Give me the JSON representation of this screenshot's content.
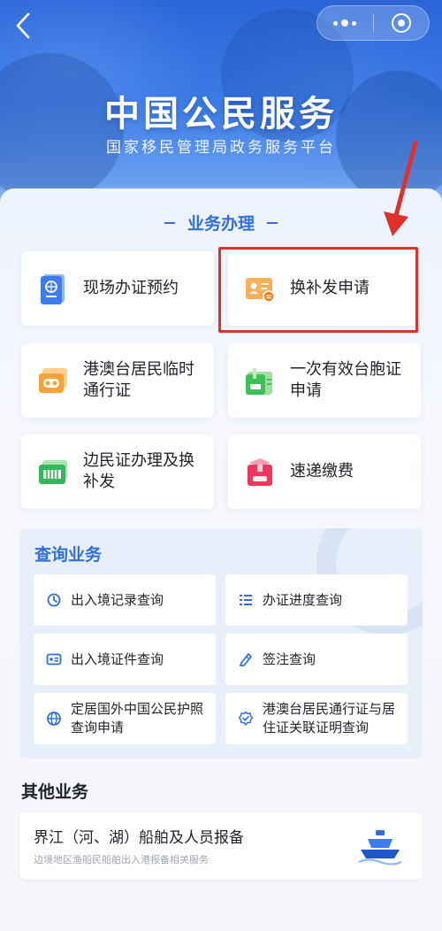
{
  "header": {
    "title": "中国公民服务",
    "subtitle": "国家移民管理局政务服务平台"
  },
  "business": {
    "section_title": "业务办理",
    "tiles": [
      {
        "label": "现场办证预约",
        "icon": "passport-icon"
      },
      {
        "label": "换补发申请",
        "icon": "id-card-icon"
      },
      {
        "label": "港澳台居民临时通行证",
        "icon": "pass-card-icon"
      },
      {
        "label": "一次有效台胞证申请",
        "icon": "taiwan-permit-icon"
      },
      {
        "label": "边民证办理及换补发",
        "icon": "border-card-icon"
      },
      {
        "label": "速递缴费",
        "icon": "package-icon"
      }
    ]
  },
  "query": {
    "title": "查询业务",
    "items": [
      {
        "label": "出入境记录查询",
        "icon": "history-icon"
      },
      {
        "label": "办证进度查询",
        "icon": "checklist-icon"
      },
      {
        "label": "出入境证件查询",
        "icon": "document-card-icon"
      },
      {
        "label": "签注查询",
        "icon": "stamp-icon"
      },
      {
        "label": "定居国外中国公民护照查询申请",
        "icon": "globe-icon"
      },
      {
        "label": "港澳台居民通行证与居住证关联证明查询",
        "icon": "badge-check-icon"
      }
    ]
  },
  "other": {
    "title": "其他业务",
    "card": {
      "label": "界江（河、湖）船舶及人员报备",
      "sublabel": "边境地区渔船民船舶出入港报备相关服务",
      "icon": "ship-icon"
    }
  },
  "colors": {
    "accent": "#2f6fe0",
    "highlight": "#e0302a"
  }
}
